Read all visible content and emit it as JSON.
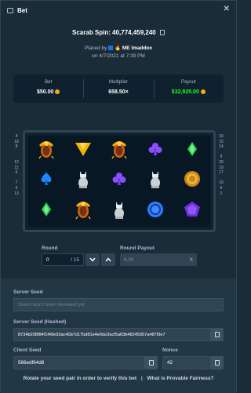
{
  "window": {
    "title": "Bet",
    "close_label": "✕"
  },
  "spin": {
    "title": "Scarab Spin: 40,774,459,240"
  },
  "placed": {
    "prefix": "Placed by",
    "user": "ME Imaddox",
    "date": "on 4/7/2021 at 7:39 PM"
  },
  "stats": {
    "bet_label": "Bet",
    "bet_value": "$50.00",
    "multiplier_label": "Multiplier",
    "multiplier_value": "658.50×",
    "payout_label": "Payout",
    "payout_value": "$32,925.00"
  },
  "colors": {
    "payout": "#1fff20",
    "coin": "#f7a918",
    "accent": "#1475e1"
  },
  "board": {
    "left_lines": [
      "4",
      "18",
      "8",
      "",
      "",
      "12",
      "11",
      "6",
      "",
      "7",
      "3",
      "13"
    ],
    "right_lines": [
      "16",
      "15",
      "14",
      "",
      "9",
      "20",
      "19",
      "17",
      "",
      "10",
      "5",
      "2"
    ],
    "grid": [
      [
        "scarab-icon",
        "triangle-gem-icon",
        "scarab-icon",
        "club-icon",
        "diamond-icon"
      ],
      [
        "spade-icon",
        "cat-statue-icon",
        "club-icon",
        "cat-statue-icon",
        "coin-icon"
      ],
      [
        "diamond-icon",
        "scarab-icon",
        "cat-statue-icon",
        "ring-icon",
        "pentagon-gem-icon"
      ]
    ]
  },
  "round": {
    "label": "Round",
    "value": "0",
    "of": "/ 15",
    "down": "⌄",
    "up": "⌃"
  },
  "round_payout": {
    "label": "Round Payout",
    "value": "6.00",
    "clear": "X"
  },
  "fairness": {
    "server_seed_label": "Server Seed",
    "server_seed_placeholder": "Seed hasn't been revealed yet",
    "server_hashed_label": "Server Seed (Hashed)",
    "server_hashed_value": "8734b208f84f1f49e93ac40b7d17bd81e4efda1facf5a63b48245057a487f3e7",
    "client_seed_label": "Client Seed",
    "client_seed_value": "566edf64d6",
    "nonce_label": "Nonce",
    "nonce_value": "42",
    "footer_text": "Rotate your seed pair in order to verify this bet",
    "footer_sep": "|",
    "footer_link": "What is Provable Fairness?"
  }
}
